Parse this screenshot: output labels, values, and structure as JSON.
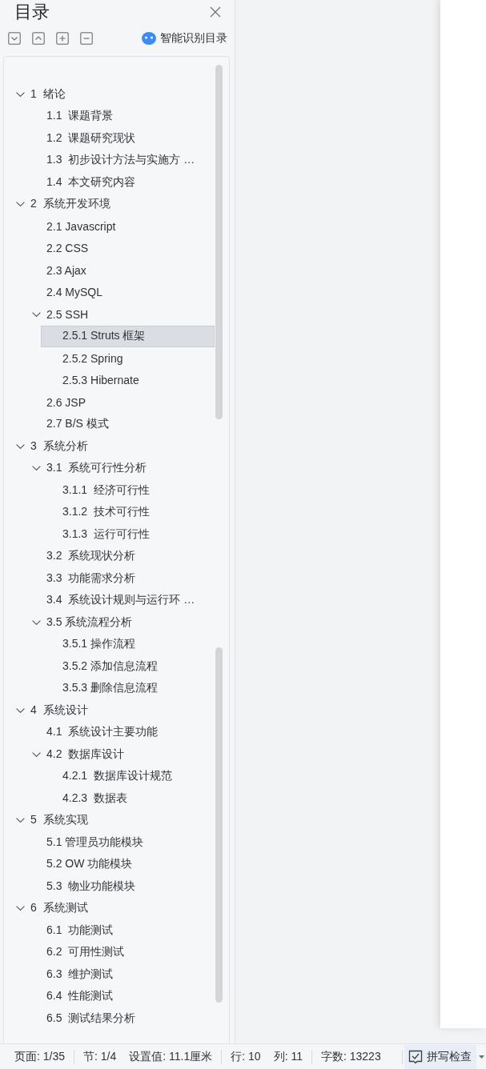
{
  "panel": {
    "title": "目录",
    "smart_button": {
      "label": "智能识别目录"
    }
  },
  "toc": {
    "items": [
      {
        "label": "1  绪论",
        "expanded": true,
        "selected": false,
        "children": [
          {
            "label": "1.1  课题背景",
            "selected": false
          },
          {
            "label": "1.2  课题研究现状",
            "selected": false
          },
          {
            "label": "1.3  初步设计方法与实施方 …",
            "selected": false
          },
          {
            "label": "1.4  本文研究内容",
            "selected": false
          }
        ]
      },
      {
        "label": "2  系统开发环境",
        "expanded": true,
        "selected": false,
        "children": [
          {
            "label": "2.1 Javascript",
            "selected": false
          },
          {
            "label": "2.2 CSS",
            "selected": false
          },
          {
            "label": "2.3 Ajax",
            "selected": false
          },
          {
            "label": "2.4 MySQL",
            "selected": false
          },
          {
            "label": "2.5 SSH",
            "expanded": true,
            "selected": false,
            "children": [
              {
                "label": "2.5.1 Struts 框架",
                "selected": true
              },
              {
                "label": "2.5.2 Spring",
                "selected": false
              },
              {
                "label": "2.5.3 Hibernate",
                "selected": false
              }
            ]
          },
          {
            "label": "2.6 JSP",
            "selected": false
          },
          {
            "label": "2.7 B/S 模式",
            "selected": false
          }
        ]
      },
      {
        "label": "3  系统分析",
        "expanded": true,
        "selected": false,
        "children": [
          {
            "label": "3.1  系统可行性分析",
            "expanded": true,
            "selected": false,
            "children": [
              {
                "label": "3.1.1  经济可行性",
                "selected": false
              },
              {
                "label": "3.1.2  技术可行性",
                "selected": false
              },
              {
                "label": "3.1.3  运行可行性",
                "selected": false
              }
            ]
          },
          {
            "label": "3.2  系统现状分析",
            "selected": false
          },
          {
            "label": "3.3  功能需求分析",
            "selected": false
          },
          {
            "label": "3.4  系统设计规则与运行环 …",
            "selected": false
          },
          {
            "label": "3.5 系统流程分析",
            "expanded": true,
            "selected": false,
            "children": [
              {
                "label": "3.5.1 操作流程",
                "selected": false
              },
              {
                "label": "3.5.2 添加信息流程",
                "selected": false
              },
              {
                "label": "3.5.3 删除信息流程",
                "selected": false
              }
            ]
          }
        ]
      },
      {
        "label": "4  系统设计",
        "expanded": true,
        "selected": false,
        "children": [
          {
            "label": "4.1  系统设计主要功能",
            "selected": false
          },
          {
            "label": "4.2  数据库设计",
            "expanded": true,
            "selected": false,
            "children": [
              {
                "label": "4.2.1  数据库设计规范",
                "selected": false
              },
              {
                "label": "4.2.3  数据表",
                "selected": false
              }
            ]
          }
        ]
      },
      {
        "label": "5  系统实现",
        "expanded": true,
        "selected": false,
        "children": [
          {
            "label": "5.1 管理员功能模块",
            "selected": false
          },
          {
            "label": "5.2 OW 功能模块",
            "selected": false
          },
          {
            "label": "5.3  物业功能模块",
            "selected": false
          }
        ]
      },
      {
        "label": "6  系统测试",
        "expanded": true,
        "selected": false,
        "children": [
          {
            "label": "6.1  功能测试",
            "selected": false
          },
          {
            "label": "6.2  可用性测试",
            "selected": false
          },
          {
            "label": "6.3  维护测试",
            "selected": false
          },
          {
            "label": "6.4  性能测试",
            "selected": false
          },
          {
            "label": "6.5  测试结果分析",
            "selected": false
          }
        ]
      }
    ]
  },
  "status_bar": {
    "groups": [
      {
        "items": [
          "页面: 1/35"
        ]
      },
      {
        "items": [
          "节: 1/4",
          "设置值: 11.1厘米"
        ]
      },
      {
        "items": [
          "行: 10",
          "列: 11"
        ]
      },
      {
        "items": [
          "字数: 13223"
        ]
      }
    ],
    "spell_check": {
      "label": "拼写检查"
    }
  }
}
